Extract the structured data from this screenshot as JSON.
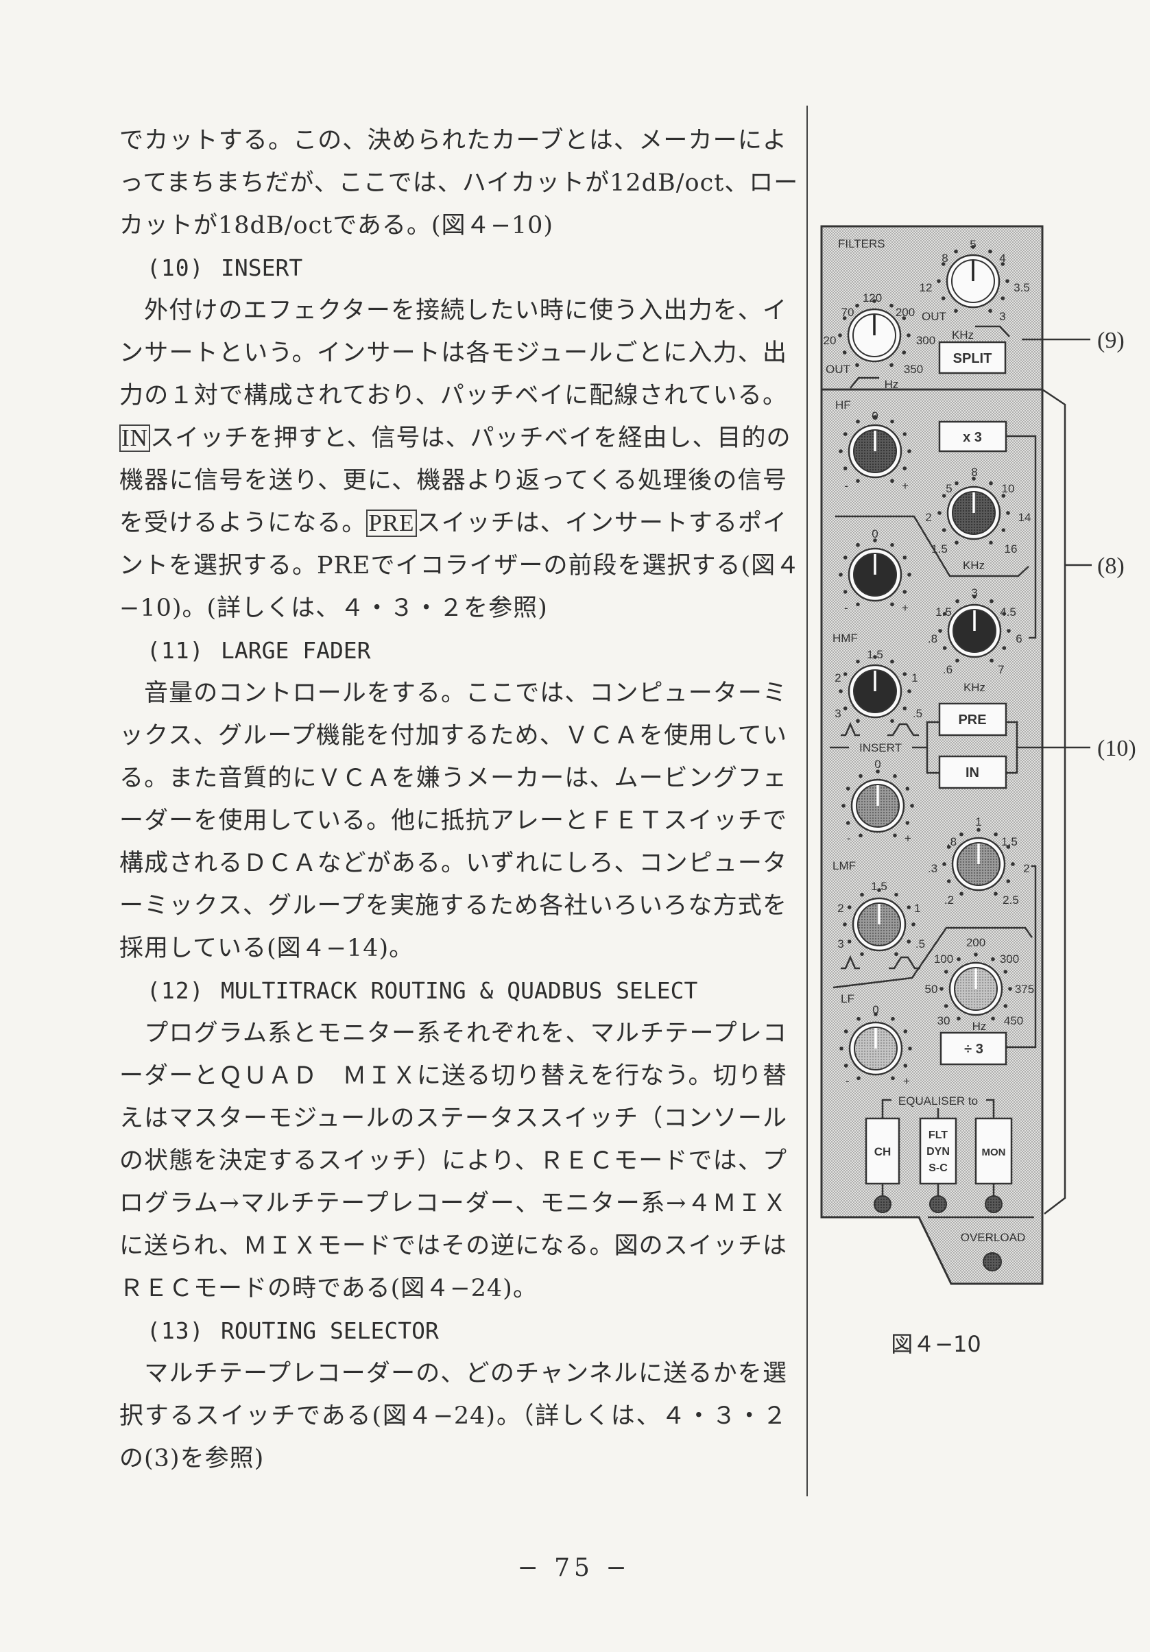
{
  "body": {
    "lines": [
      "でカットする。この、決められたカーブとは、メーカーによ",
      "ってまちまちだが、ここでは、ハイカットが12dB/oct、ロー",
      "カットが18dB/octである。(図４−10)",
      "",
      "　外付けのエフェクターを接続したい時に使う入出力を、イ",
      "ンサートという。インサートは各モジュールごとに入力、出",
      "力の１対で構成されており、パッチベイに配線されている。",
      "スイッチを押すと、信号は、パッチベイを経由し、目的の",
      "機器に信号を送り、更に、機器より返ってくる処理後の信号",
      "スイッチは、インサートするポイ",
      "ントを選択する。PREでイコライザーの前段を選択する(図４",
      "−10)。(詳しくは、４・３・２を参照)",
      "",
      "　音量のコントロールをする。ここでは、コンピューターミ",
      "ックス、グループ機能を付加するため、ＶＣＡを使用してい",
      "る。また音質的にＶＣＡを嫌うメーカーは、ムービングフェ",
      "ーダーを使用している。他に抵抗アレーとＦＥＴスイッチで",
      "構成されるＤＣＡなどがある。いずれにしろ、コンピュータ",
      "ーミックス、グループを実施するため各社いろいろな方式を",
      "採用している(図４−14)。",
      "",
      "　プログラム系とモニター系それぞれを、マルチテープレコ",
      "ーダーとＱＵＡＤ　ＭＩＸに送る切り替えを行なう。切り替",
      "えはマスターモジュールのステータススイッチ（コンソール",
      "の状態を決定するスイッチ）により、ＲＥＣモードでは、プ",
      "ログラム→マルチテープレコーダー、モニター系→４ＭＩＸ",
      "に送られ、ＭＩＸモードではその逆になる。図のスイッチは",
      "ＲＥＣモードの時である(図４−24)。",
      "",
      "　マルチテープレコーダーの、どのチャンネルに送るかを選",
      "択するスイッチである(図４−24)。（詳しくは、４・３・２",
      "の(3)を参照)"
    ],
    "line10_prefix": "を受けるようになる。",
    "boxed_in": "IN",
    "boxed_pre": "PRE",
    "headings": [
      {
        "num": "(10)",
        "title": "INSERT"
      },
      {
        "num": "(11)",
        "title": "LARGE FADER"
      },
      {
        "num": "(12)",
        "title": "MULTITRACK ROUTING & QUADBUS SELECT"
      },
      {
        "num": "(13)",
        "title": "ROUTING SELECTOR"
      }
    ]
  },
  "figure": {
    "filters_title": "FILTERS",
    "hf_cut_scale": [
      "5",
      "8",
      "4",
      "12",
      "3.5",
      "OUT",
      "3"
    ],
    "khz": "KHz",
    "hz": "Hz",
    "lf_cut_scale": [
      "120",
      "70",
      "200",
      "20",
      "300",
      "OUT",
      "350"
    ],
    "split": "SPLIT",
    "hf_label": "HF",
    "gain_scale": [
      "0",
      "-",
      "+"
    ],
    "x3": "x 3",
    "hf_freq_scale": [
      "8",
      "5",
      "10",
      "2",
      "14",
      "1.5",
      "16"
    ],
    "hmf_label": "HMF",
    "hmf_freq_scale": [
      "3",
      "1.5",
      "4.5",
      ".8",
      "6",
      ".6",
      "7"
    ],
    "q_scale": [
      "1.5",
      "2",
      "1",
      "3",
      ".5"
    ],
    "insert_label": "INSERT",
    "pre": "PRE",
    "in": "IN",
    "lmf_label": "LMF",
    "lmf_freq_scale": [
      "1",
      ".8",
      "1.5",
      ".3",
      "2",
      ".2",
      "2.5"
    ],
    "lf_label": "LF",
    "lf_freq_scale": [
      "200",
      "100",
      "300",
      "50",
      "375",
      "30",
      "450"
    ],
    "div3": "÷ 3",
    "eq_to": "EQUALISER to",
    "ch": "CH",
    "flt": [
      "FLT",
      "DYN",
      "S-C"
    ],
    "mon": "MON",
    "overload": "OVERLOAD",
    "callouts": [
      "(9)",
      "(8)",
      "(10)"
    ],
    "caption": "図４−10"
  },
  "page_number": "− 75 −"
}
